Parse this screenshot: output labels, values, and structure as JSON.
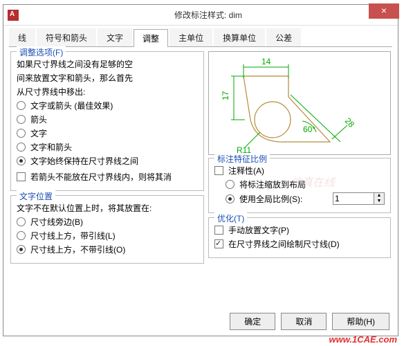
{
  "window": {
    "title": "修改标注样式: dim"
  },
  "tabs": [
    "线",
    "符号和箭头",
    "文字",
    "调整",
    "主单位",
    "换算单位",
    "公差"
  ],
  "active_tab": 3,
  "fit_options": {
    "legend": "调整选项(F)",
    "intro1": "如果尺寸界线之间没有足够的空",
    "intro2": "间来放置文字和箭头，那么首先",
    "intro3": "从尺寸界线中移出:",
    "items": [
      {
        "label": "文字或箭头 (最佳效果)",
        "type": "radio",
        "sel": false
      },
      {
        "label": "箭头",
        "type": "radio",
        "sel": false
      },
      {
        "label": "文字",
        "type": "radio",
        "sel": false
      },
      {
        "label": "文字和箭头",
        "type": "radio",
        "sel": false
      },
      {
        "label": "文字始终保持在尺寸界线之间",
        "type": "radio",
        "sel": true
      },
      {
        "label": "若箭头不能放在尺寸界线内，则将其消",
        "type": "check",
        "sel": false
      }
    ]
  },
  "text_pos": {
    "legend": "文字位置",
    "intro": "文字不在默认位置上时，将其放置在:",
    "items": [
      {
        "label": "尺寸线旁边(B)",
        "sel": false
      },
      {
        "label": "尺寸线上方，带引线(L)",
        "sel": false
      },
      {
        "label": "尺寸线上方，不带引线(O)",
        "sel": true
      }
    ]
  },
  "scale": {
    "legend": "标注特征比例",
    "items": [
      {
        "label": "注释性(A)",
        "type": "check",
        "sel": false
      },
      {
        "label": "将标注缩放到布局",
        "type": "radio",
        "sel": false
      },
      {
        "label": "使用全局比例(S):",
        "type": "radio",
        "sel": true
      }
    ],
    "value": "1"
  },
  "optimize": {
    "legend": "优化(T)",
    "items": [
      {
        "label": "手动放置文字(P)",
        "sel": false
      },
      {
        "label": "在尺寸界线之间绘制尺寸线(D)",
        "sel": true
      }
    ]
  },
  "preview": {
    "d1": "14",
    "d2": "17",
    "d3": "60°",
    "d4": "R11",
    "d5": "28"
  },
  "buttons": {
    "ok": "确定",
    "cancel": "取消",
    "help": "帮助(H)"
  },
  "watermark": "www.1CAE.com",
  "watermark2": "仿真在线"
}
